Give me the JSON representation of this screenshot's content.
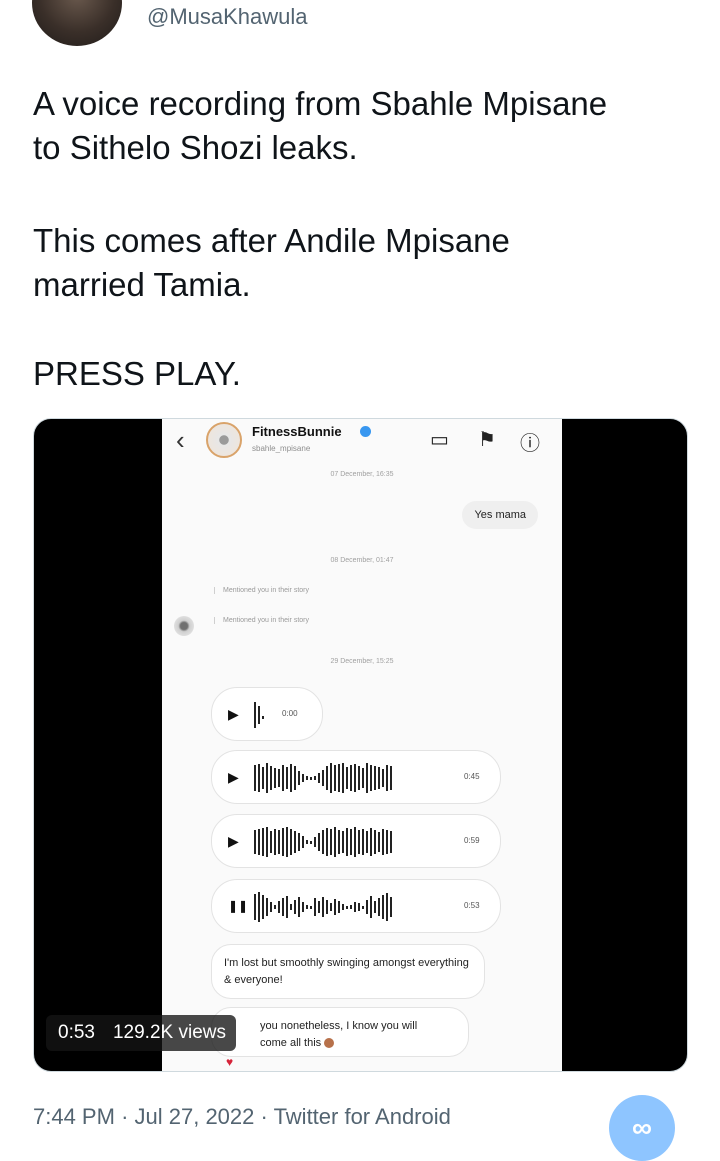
{
  "author": {
    "handle": "@MusaKhawula"
  },
  "tweet": {
    "line1": "A voice recording from Sbahle Mpisane",
    "line2": "to Sithelo Shozi leaks.",
    "line3": "This comes after Andile Mpisane",
    "line4": "married Tamia.",
    "line5": "PRESS PLAY."
  },
  "video": {
    "time": "0:53",
    "views": "129.2K views",
    "screen": {
      "contact_name": "FitnessBunnie",
      "contact_username": "sbahle_mpisane",
      "date1": "07 December, 16:35",
      "reply1": "Yes mama",
      "date2": "08 December, 01:47",
      "mention1": "Mentioned you in their story",
      "mention2": "Mentioned you in their story",
      "date3": "29 December, 15:25",
      "voice_notes": [
        {
          "duration": "0:00"
        },
        {
          "duration": "0:45"
        },
        {
          "duration": "0:59"
        },
        {
          "duration": "0:53"
        }
      ],
      "msg1": "I'm lost but smoothly swinging amongst everything & everyone!",
      "msg2_line1": "you nonetheless, I know you will",
      "msg2_line2": "come all this"
    }
  },
  "footer": {
    "time": "7:44 PM",
    "date": "Jul 27, 2022",
    "source": "Twitter for Android"
  },
  "colors": {
    "link_gray": "#536471",
    "fab": "#8ec5ff"
  }
}
